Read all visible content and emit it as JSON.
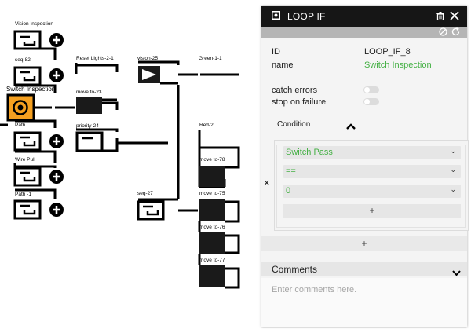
{
  "canvas": {
    "nodes": {
      "vision_inspection": "Vision Inspection",
      "seq_82": "seq-82",
      "switch_inspection": "Switch Inspection",
      "path": "Path",
      "wire_pull": "Wire Pull",
      "path_1": "Path -1",
      "reset_lights": "Reset Lights-2-1",
      "move_to_23": "move to-23",
      "priority_24": "priority-24",
      "vision_25": "vision-25",
      "green_1_1": "Green-1-1",
      "red_2": "Red-2",
      "move_to_78": "move to-78",
      "move_to_75": "move to-75",
      "move_to_76": "move to-76",
      "move_to_77": "move to-77",
      "seq_27": "seq-27"
    },
    "accent_color": "#f5a020"
  },
  "panel": {
    "title": "LOOP IF",
    "header_icons": [
      "loop-node-icon",
      "trash-icon",
      "close-icon"
    ],
    "subbar_icons": [
      "disable-icon",
      "reset-icon"
    ],
    "id_label": "ID",
    "id_value": "LOOP_IF_8",
    "name_label": "name",
    "name_value": "Switch Inspection",
    "catch_errors_label": "catch errors",
    "stop_on_failure_label": "stop on failure",
    "condition_label": "Condition",
    "remove_symbol": "×",
    "condition": {
      "variable": "Switch Pass",
      "operator": "==",
      "value": "0"
    },
    "add_symbol": "+",
    "comments_label": "Comments",
    "comments_placeholder": "Enter comments here.",
    "value_color": "#44b044"
  }
}
